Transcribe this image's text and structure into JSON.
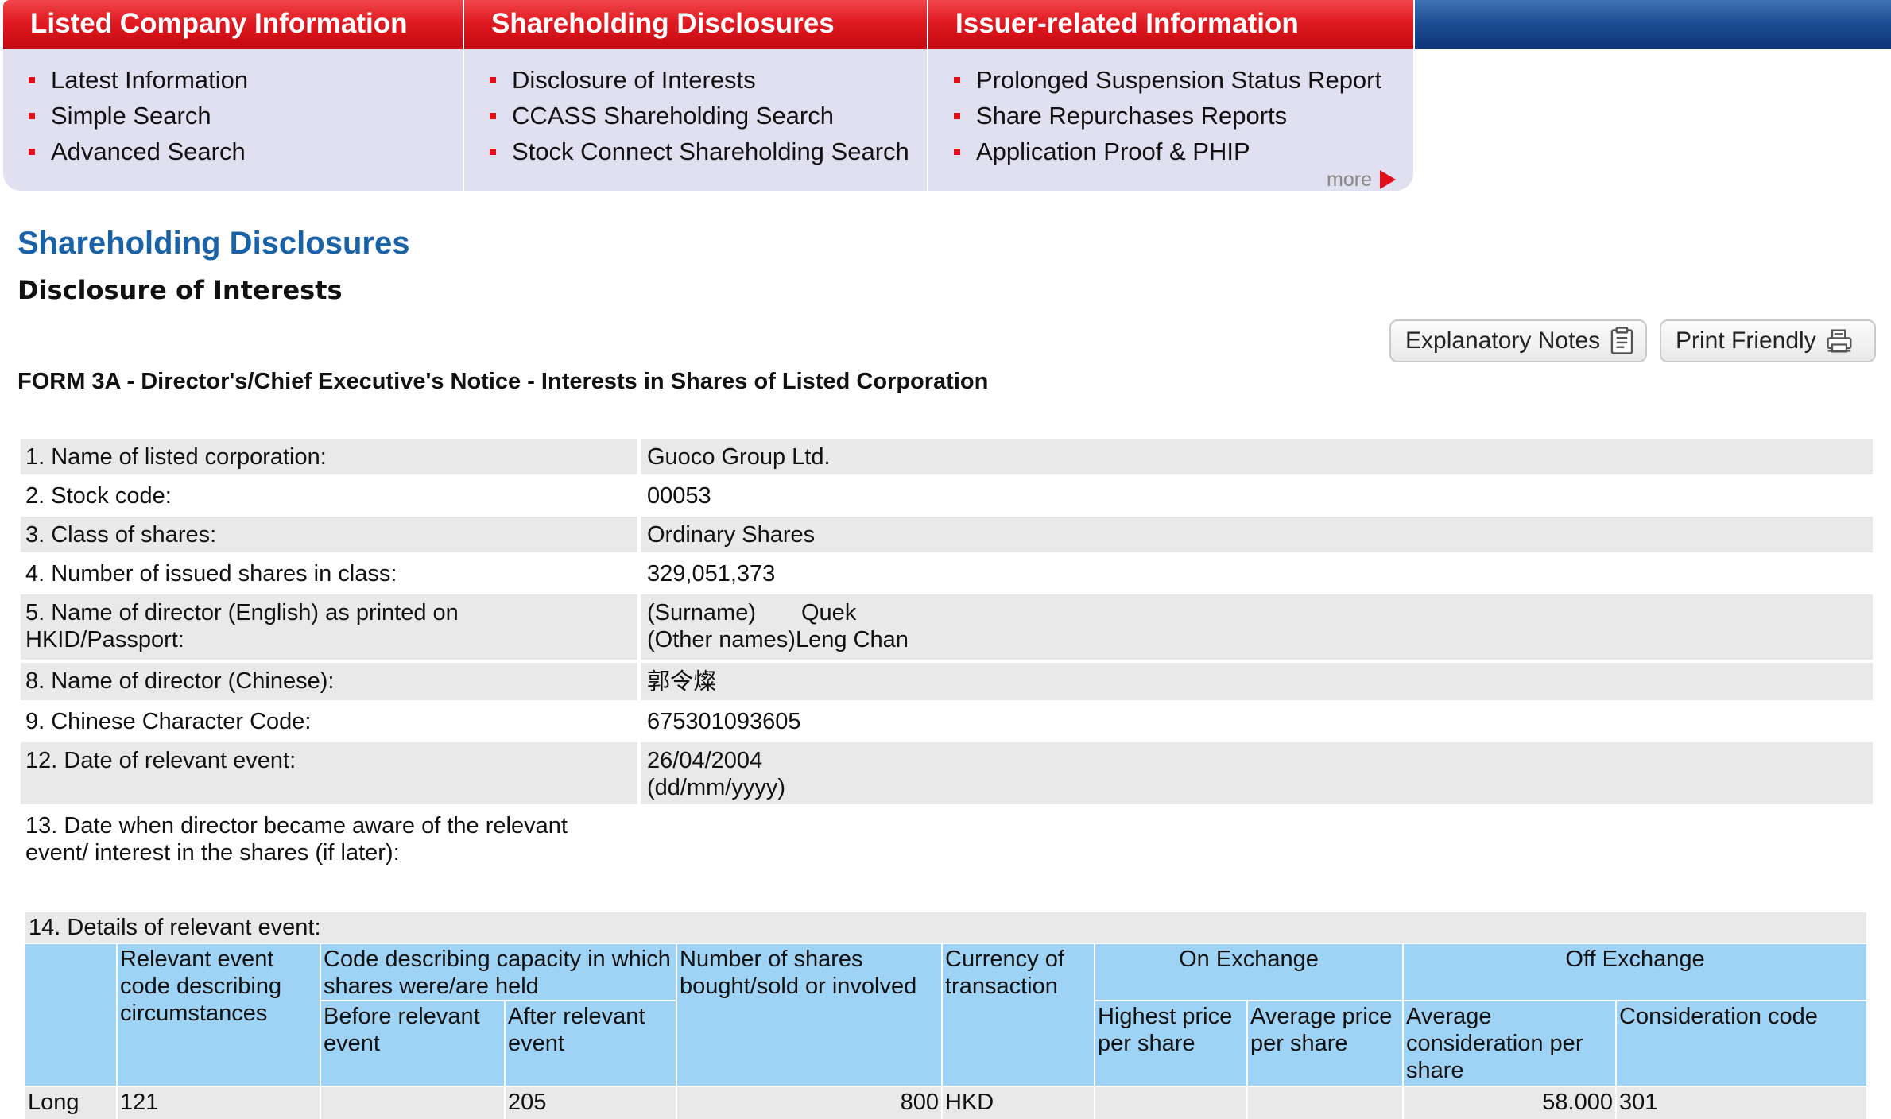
{
  "menu": {
    "columns": [
      {
        "title": "Listed Company Information",
        "items": [
          "Latest Information",
          "Simple Search",
          "Advanced Search"
        ]
      },
      {
        "title": "Shareholding Disclosures",
        "items": [
          "Disclosure of Interests",
          "CCASS Shareholding Search",
          "Stock Connect Shareholding Search"
        ]
      },
      {
        "title": "Issuer-related Information",
        "items": [
          "Prolonged Suspension Status Report",
          "Share Repurchases Reports",
          "Application Proof & PHIP"
        ]
      }
    ],
    "more_label": "more"
  },
  "page": {
    "title": "Shareholding Disclosures",
    "subtitle": "Disclosure of Interests",
    "form_title": "FORM 3A - Director's/Chief Executive's Notice - Interests in Shares of Listed Corporation"
  },
  "toolbar": {
    "notes_label": "Explanatory Notes",
    "print_label": "Print Friendly"
  },
  "form": {
    "listed_corp_label": "1. Name of listed corporation:",
    "listed_corp_value": "Guoco Group Ltd.",
    "stock_code_label": "2. Stock code:",
    "stock_code_value": "00053",
    "class_label": "3. Class of shares:",
    "class_value": "Ordinary Shares",
    "issued_label": "4. Number of issued shares in class:",
    "issued_value": "329,051,373",
    "director_en_label_line1": "5. Name of director (English) as printed on",
    "director_en_label_line2": "HKID/Passport:",
    "surname_label": "(Surname)",
    "surname_value": "Quek",
    "other_names_label": "(Other names)",
    "other_names_value": "Leng Chan",
    "director_cn_label": "8. Name of director (Chinese):",
    "director_cn_value": "郭令燦",
    "ccc_label": "9. Chinese Character Code:",
    "ccc_value": "675301093605",
    "event_date_label": "12. Date of relevant event:",
    "event_date_value": "26/04/2004",
    "event_date_format": "(dd/mm/yyyy)",
    "aware_label_line1": "13. Date when director became aware of the relevant",
    "aware_label_line2": "event/ interest in the shares (if later):",
    "aware_value": ""
  },
  "details": {
    "caption": "14. Details of relevant event:",
    "headers": {
      "event_code": "Relevant event code describing circumstances",
      "capacity": "Code describing capacity in which shares were/are held",
      "before": "Before relevant event",
      "after": "After relevant event",
      "num_shares": "Number of shares bought/sold or involved",
      "currency": "Currency of transaction",
      "on_exchange": "On Exchange",
      "highest": "Highest price per share",
      "average": "Average price per share",
      "off_exchange": "Off Exchange",
      "avg_consideration": "Average consideration per share",
      "consideration_code": "Consideration code"
    },
    "rows": [
      {
        "position": "Long",
        "event_code": "121",
        "before": "",
        "after": "205",
        "num_shares": "800",
        "currency": "HKD",
        "highest": "",
        "average": "",
        "avg_consideration": "58.000",
        "consideration_code": "301"
      }
    ]
  }
}
